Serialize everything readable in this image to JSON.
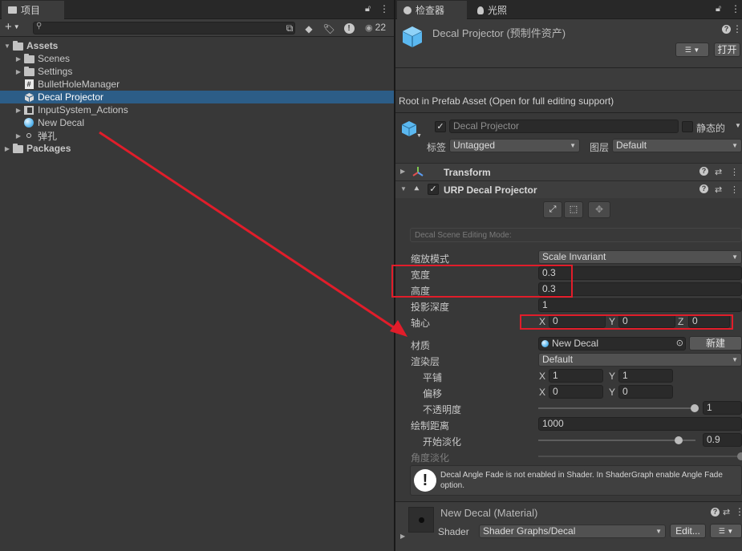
{
  "project": {
    "tab_label": "项目",
    "add_label": "+",
    "visible_count": "22",
    "search_placeholder": "",
    "tree": [
      {
        "label": "Assets",
        "icon": "folder-open-icon"
      },
      {
        "label": "Scenes",
        "icon": "folder-icon"
      },
      {
        "label": "Settings",
        "icon": "folder-icon"
      },
      {
        "label": "BulletHoleManager",
        "icon": "csharp-script-icon"
      },
      {
        "label": "Decal Projector",
        "icon": "prefab-icon"
      },
      {
        "label": "InputSystem_Actions",
        "icon": "input-actions-icon"
      },
      {
        "label": "New Decal",
        "icon": "material-icon"
      },
      {
        "label": "弹孔",
        "icon": "texture-icon"
      },
      {
        "label": "Packages",
        "icon": "folder-icon"
      }
    ]
  },
  "inspector": {
    "tab_inspector": "检查器",
    "tab_lighting": "光照",
    "asset_title": "Decal Projector (预制件资产)",
    "open_button": "打开",
    "prefab_notice": "Root in Prefab Asset (Open for full editing support)",
    "object_name": "Decal Projector",
    "static_label": "静态的",
    "tag_label": "标签",
    "tag_value": "Untagged",
    "layer_label": "图层",
    "layer_value": "Default",
    "transform_title": "Transform",
    "urp_title": "URP Decal Projector",
    "edit_mode_label": "Decal Scene Editing Mode:",
    "fields": {
      "scale_mode_label": "缩放模式",
      "scale_mode_value": "Scale Invariant",
      "width_label": "宽度",
      "width_value": "0.3",
      "height_label": "高度",
      "height_value": "0.3",
      "projection_depth_label": "投影深度",
      "projection_depth_value": "1",
      "pivot_label": "轴心",
      "pivot_x": "0",
      "pivot_y": "0",
      "pivot_z": "0",
      "material_label": "材质",
      "material_value": "New Decal",
      "new_button": "新建",
      "rendering_layer_label": "渲染层",
      "rendering_layer_value": "Default",
      "tiling_label": "平铺",
      "tiling_x": "1",
      "tiling_y": "1",
      "offset_label": "偏移",
      "offset_x": "0",
      "offset_y": "0",
      "opacity_label": "不透明度",
      "opacity_value": "1",
      "draw_distance_label": "绘制距离",
      "draw_distance_value": "1000",
      "start_fade_label": "开始淡化",
      "start_fade_value": "0.9",
      "angle_fade_label": "角度淡化",
      "angle_fade_warning": "Decal Angle Fade is not enabled in Shader. In ShaderGraph enable Angle Fade option.",
      "x": "X",
      "y": "Y",
      "z": "Z"
    },
    "material_section": {
      "title": "New Decal (Material)",
      "shader_label": "Shader",
      "shader_value": "Shader Graphs/Decal",
      "edit_button": "Edit..."
    }
  },
  "slider_levels": {
    "opacity": 1.0,
    "start_fade": 0.9,
    "angle_fade": 1.0
  },
  "colors": {
    "annotation": "#e11d2a",
    "selection": "#2c5d87",
    "prefab_icon": "#5bb8f0"
  }
}
